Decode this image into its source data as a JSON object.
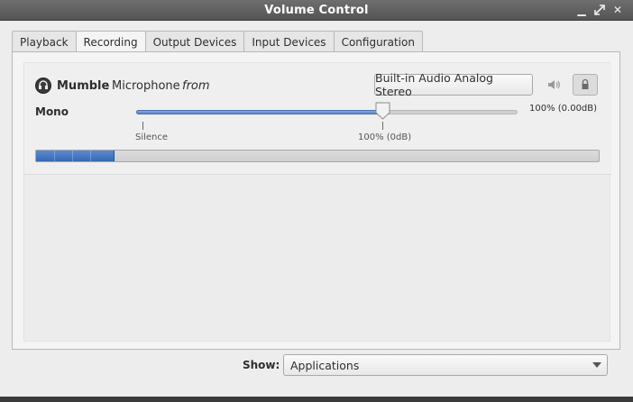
{
  "window": {
    "title": "Volume Control",
    "controls": [
      "minimize",
      "maximize",
      "close"
    ]
  },
  "tabs": [
    {
      "label": "Playback",
      "active": false
    },
    {
      "label": "Recording",
      "active": true
    },
    {
      "label": "Output Devices",
      "active": false
    },
    {
      "label": "Input Devices",
      "active": false
    },
    {
      "label": "Configuration",
      "active": false
    }
  ],
  "stream": {
    "app_name": "Mumble",
    "separator": ":",
    "stream_name": "Microphone",
    "from_text": "from",
    "device": "Built-in Audio Analog Stereo",
    "channel": "Mono",
    "volume_text": "100% (0.00dB)",
    "volume_fraction": 0.65,
    "marks": {
      "silence": "Silence",
      "unity": "100% (0dB)"
    },
    "meter_level": 0.14,
    "icons": {
      "app": "headset-icon",
      "speaker": "speaker-icon",
      "lock": "lock-icon"
    }
  },
  "footer": {
    "show_label": "Show:",
    "show_value": "Applications"
  },
  "colors": {
    "accent": "#3668b3",
    "titlebar": "#5f5f5f"
  }
}
